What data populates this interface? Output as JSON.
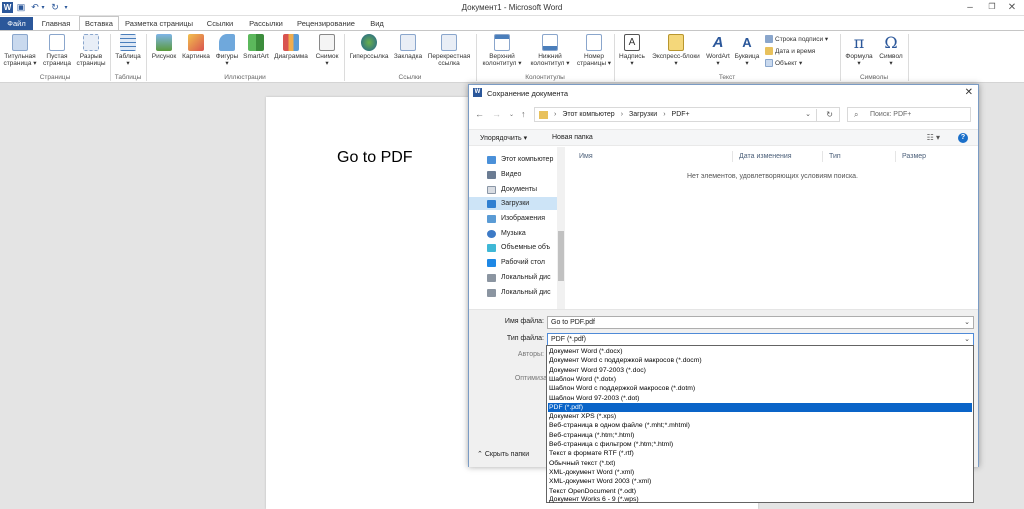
{
  "app": {
    "title": "Документ1 - Microsoft Word"
  },
  "tabs": [
    "Файл",
    "Главная",
    "Вставка",
    "Разметка страницы",
    "Ссылки",
    "Рассылки",
    "Рецензирование",
    "Вид"
  ],
  "ribbon": {
    "buttons": [
      "Титульная\nстраница ▾",
      "Пустая\nстраница",
      "Разрыв\nстраницы",
      "Таблица\n▾",
      "Рисунок",
      "Картинка",
      "Фигуры\n▾",
      "SmartArt",
      "Диаграмма",
      "Снимок\n▾",
      "Гиперссылка",
      "Закладка",
      "Перекрестная\nссылка",
      "Верхний\nколонтитул ▾",
      "Нижний\nколонтитул ▾",
      "Номер\nстраницы ▾",
      "Надпись\n▾",
      "Экспресс-блоки\n▾",
      "WordArt\n▾",
      "Буквица\n▾",
      "Формула\n▾",
      "Символ\n▾"
    ],
    "small_buttons": [
      "Строка подписи ▾",
      "Дата и время",
      "Объект ▾"
    ],
    "groups": [
      "Страницы",
      "Таблицы",
      "Иллюстрации",
      "Ссылки",
      "Колонтитулы",
      "Текст",
      "Символы"
    ]
  },
  "document": {
    "text": "Go to PDF"
  },
  "dialog": {
    "title": "Сохранение документа",
    "breadcrumb": [
      "Этот компьютер",
      "Загрузки",
      "PDF+"
    ],
    "search_placeholder": "Поиск: PDF+",
    "organize": "Упорядочить ▾",
    "new_folder": "Новая папка",
    "nav_items": [
      "Этот компьютер",
      "Видео",
      "Документы",
      "Загрузки",
      "Изображения",
      "Музыка",
      "Объемные объ",
      "Рабочий стол",
      "Локальный дис",
      "Локальный дис"
    ],
    "columns": [
      "Имя",
      "Дата изменения",
      "Тип",
      "Размер"
    ],
    "empty_message": "Нет элементов, удовлетворяющих условиям поиска.",
    "filename_label": "Имя файла:",
    "filename_value": "Go to PDF.pdf",
    "filetype_label": "Тип файла:",
    "filetype_value": "PDF (*.pdf)",
    "authors_label": "Авторы:",
    "optimize_label": "Оптимиза",
    "hide_folders": "Скрыть папки",
    "filetype_options": [
      "Документ Word (*.docx)",
      "Документ Word с поддержкой макросов (*.docm)",
      "Документ Word 97-2003 (*.doc)",
      "Шаблон Word (*.dotx)",
      "Шаблон Word с поддержкой макросов (*.dotm)",
      "Шаблон Word 97-2003 (*.dot)",
      "PDF (*.pdf)",
      "Документ XPS (*.xps)",
      "Веб-страница в одном файле (*.mht;*.mhtml)",
      "Веб-страница (*.htm;*.html)",
      "Веб-страница с фильтром (*.htm;*.html)",
      "Текст в формате RTF (*.rtf)",
      "Обычный текст (*.txt)",
      "XML-документ Word (*.xml)",
      "XML-документ Word 2003 (*.xml)",
      "Текст OpenDocument (*.odt)",
      "Документ Works 6 - 9 (*.wps)"
    ],
    "selected_option": "PDF (*.pdf)"
  },
  "colors": {
    "accent": "#2b579a",
    "highlight": "#0a64c8",
    "nav_selected": "#cde4f7"
  }
}
